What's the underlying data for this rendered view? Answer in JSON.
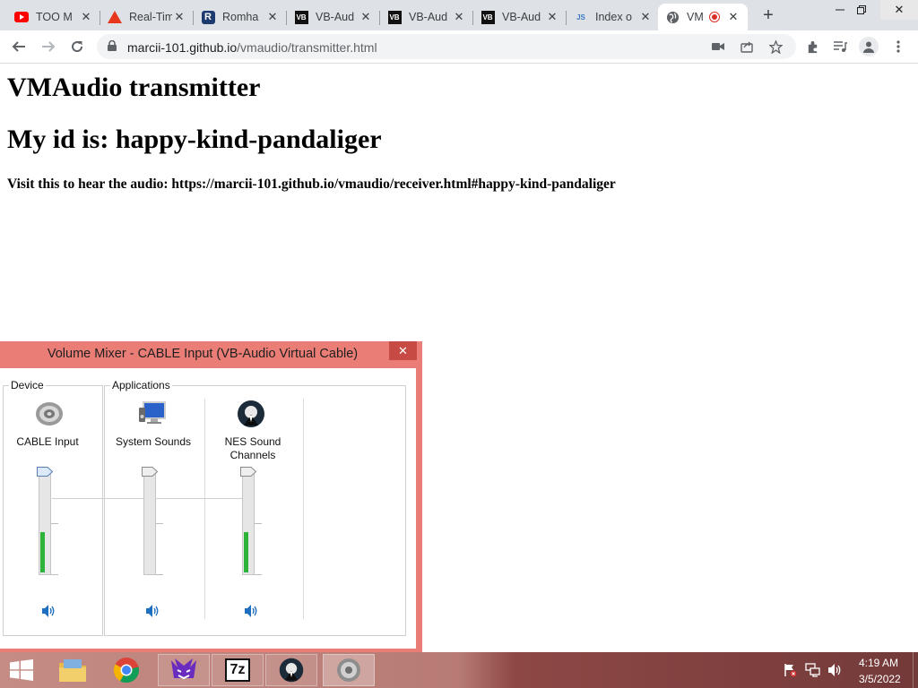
{
  "browser": {
    "tabs": [
      {
        "title": "TOO M",
        "icon": "youtube-icon"
      },
      {
        "title": "Real-Tim",
        "icon": "triangle-icon"
      },
      {
        "title": "Romha",
        "icon": "r-icon"
      },
      {
        "title": "VB-Aud",
        "icon": "vb-icon"
      },
      {
        "title": "VB-Aud",
        "icon": "vb-icon"
      },
      {
        "title": "VB-Aud",
        "icon": "vb-icon"
      },
      {
        "title": "Index o",
        "icon": "js-icon"
      },
      {
        "title": "VM",
        "icon": "globe-icon",
        "active": true,
        "recording": true
      }
    ],
    "new_tab": "+",
    "vb_glyph": "VB",
    "js_glyph": "JS",
    "r_glyph": "R",
    "url_host": "marcii-101.github.io",
    "url_path": "/vmaudio/transmitter.html"
  },
  "page": {
    "title": "VMAudio transmitter",
    "id_line": "My id is: happy-kind-pandaliger",
    "visit_line": "Visit this to hear the audio: https://marcii-101.github.io/vmaudio/receiver.html#happy-kind-pandaliger"
  },
  "mixer": {
    "title": "Volume Mixer - CABLE Input (VB-Audio Virtual Cable)",
    "device_group": "Device",
    "apps_group": "Applications",
    "channels": [
      {
        "name": "CABLE Input",
        "icon": "speaker-device-icon",
        "level": 1.0,
        "meter": 0.42
      },
      {
        "name": "System Sounds",
        "icon": "system-sounds-icon",
        "level": 1.0,
        "meter": 0.0
      },
      {
        "name": "NES Sound Channels",
        "icon": "nes-app-icon",
        "level": 1.0,
        "meter": 0.42
      }
    ]
  },
  "taskbar": {
    "apps": [
      "file-explorer-icon",
      "chrome-icon",
      "game-icon",
      "7zip-icon",
      "nes-app-icon",
      "volume-mixer-icon"
    ],
    "zip_glyph": "7z",
    "time": "4:19 AM",
    "date": "3/5/2022"
  }
}
